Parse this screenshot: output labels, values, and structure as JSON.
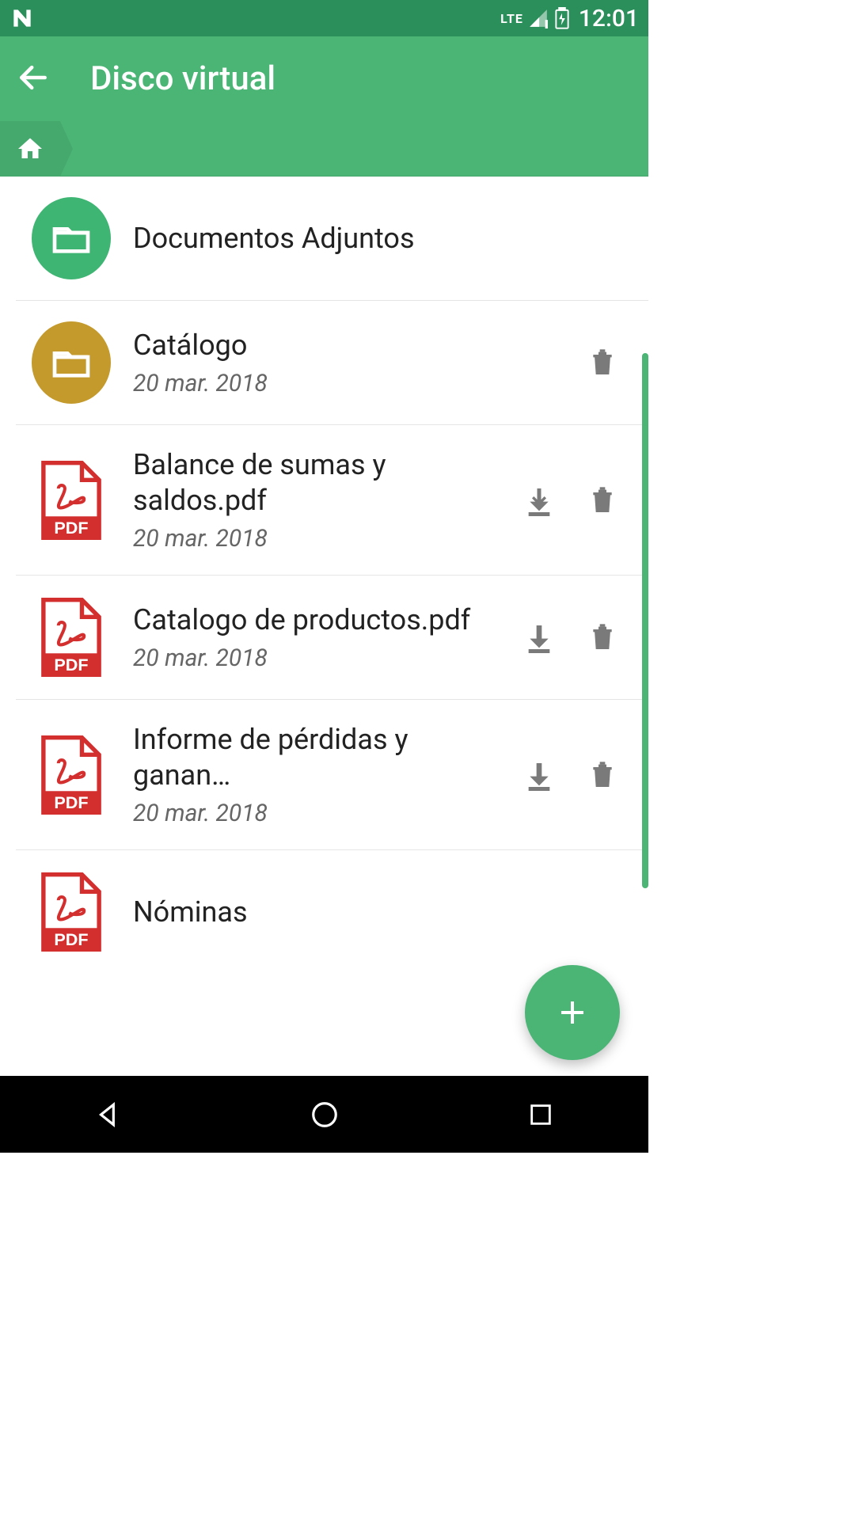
{
  "status": {
    "network": "LTE",
    "time": "12:01"
  },
  "header": {
    "title": "Disco virtual"
  },
  "items": [
    {
      "type": "folder",
      "color": "green",
      "title": "Documentos Adjuntos",
      "date": null,
      "download": false,
      "delete": false
    },
    {
      "type": "folder",
      "color": "brown",
      "title": "Catálogo",
      "date": "20 mar. 2018",
      "download": false,
      "delete": true
    },
    {
      "type": "pdf",
      "title": "Balance de sumas y saldos.pdf",
      "date": "20 mar. 2018",
      "download": true,
      "delete": true
    },
    {
      "type": "pdf",
      "title": "Catalogo de productos.pdf",
      "date": "20 mar. 2018",
      "download": true,
      "delete": true
    },
    {
      "type": "pdf",
      "title": "Informe de pérdidas y ganan…",
      "date": "20 mar. 2018",
      "download": true,
      "delete": true
    },
    {
      "type": "pdf",
      "title": "Nóminas",
      "date": null,
      "download": false,
      "delete": false
    }
  ]
}
